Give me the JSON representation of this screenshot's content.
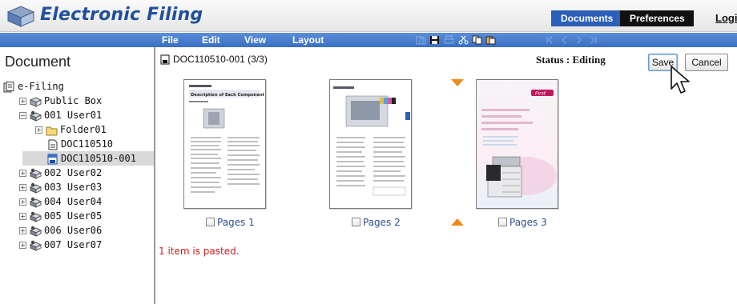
{
  "header": {
    "app_title": "Electronic Filing",
    "tabs": [
      {
        "label": "Documents",
        "active": true
      },
      {
        "label": "Preferences",
        "active": false
      }
    ],
    "logout_label": "Logi"
  },
  "left_panel": {
    "title": "Document",
    "tree": [
      {
        "label": "e-Filing",
        "icon": "efiling-icon",
        "expander": ""
      },
      {
        "label": "Public Box",
        "icon": "box-icon",
        "expander": "+"
      },
      {
        "label": "001 User01",
        "icon": "user-box-icon",
        "expander": "−"
      },
      {
        "label": "Folder01",
        "icon": "folder-icon",
        "expander": "+"
      },
      {
        "label": "DOC110510",
        "icon": "document-icon",
        "expander": ""
      },
      {
        "label": "DOC110510-001",
        "icon": "document-edit-icon",
        "expander": "",
        "selected": true
      },
      {
        "label": "002 User02",
        "icon": "user-box-icon",
        "expander": "+"
      },
      {
        "label": "003 User03",
        "icon": "user-box-icon",
        "expander": "+"
      },
      {
        "label": "004 User04",
        "icon": "user-box-icon",
        "expander": "+"
      },
      {
        "label": "005 User05",
        "icon": "user-box-icon",
        "expander": "+"
      },
      {
        "label": "006 User06",
        "icon": "user-box-icon",
        "expander": "+"
      },
      {
        "label": "007 User07",
        "icon": "user-box-icon",
        "expander": "+"
      }
    ]
  },
  "menubar": {
    "items": [
      "File",
      "Edit",
      "View",
      "Layout"
    ],
    "toolbar_icons": [
      "paste-icon",
      "save-icon",
      "print-icon",
      "cut-icon",
      "copy-icon",
      "paste-icon",
      "first-page-icon",
      "prev-page-icon",
      "next-page-icon",
      "last-page-icon"
    ]
  },
  "document": {
    "title": "DOC110510-001  (3/3)",
    "status": "Status : Editing",
    "save_label": "Save",
    "cancel_label": "Cancel",
    "pages": [
      {
        "label": "Pages 1",
        "checked": false
      },
      {
        "label": "Pages 2",
        "checked": false
      },
      {
        "label": "Pages 3",
        "checked": false
      }
    ],
    "thumb1_heading": "Description of Each Component",
    "thumb3_badge": "First",
    "message": "1 item is pasted."
  },
  "colors": {
    "brand_blue": "#1f4f9c",
    "menubar_blue": "#3a6fc2",
    "insert_arrow": "#f08a1c",
    "message_red": "#d81c1c"
  }
}
